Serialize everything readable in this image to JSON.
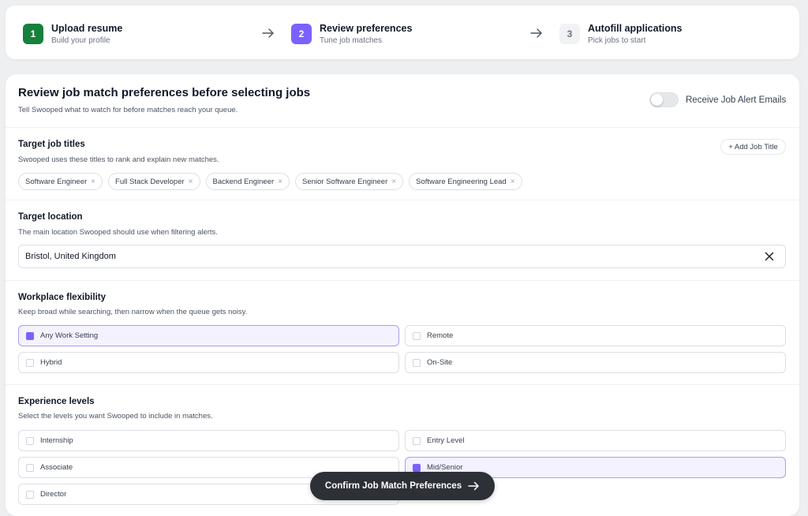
{
  "stepper": {
    "steps": [
      {
        "num": "1",
        "title": "Upload resume",
        "subtitle": "Build your profile",
        "state": "done"
      },
      {
        "num": "2",
        "title": "Review preferences",
        "subtitle": "Tune job matches",
        "state": "active"
      },
      {
        "num": "3",
        "title": "Autofill applications",
        "subtitle": "Pick jobs to start",
        "state": "todo"
      }
    ]
  },
  "header": {
    "title": "Review job match preferences before selecting jobs",
    "subtitle": "Tell Swooped what to watch for before matches reach your queue.",
    "alert_toggle_label": "Receive Job Alert Emails",
    "alert_toggle_on": false
  },
  "titles": {
    "title": "Target job titles",
    "subtitle": "Swooped uses these titles to rank and explain new matches.",
    "add_label": "+ Add Job Title",
    "chips": [
      "Software Engineer",
      "Full Stack Developer",
      "Backend Engineer",
      "Senior Software Engineer",
      "Software Engineering Lead"
    ],
    "remove_glyph": "×"
  },
  "location": {
    "title": "Target location",
    "subtitle": "The main location Swooped should use when filtering alerts.",
    "value": "Bristol, United Kingdom"
  },
  "workplace": {
    "title": "Workplace flexibility",
    "subtitle": "Keep broad while searching, then narrow when the queue gets noisy.",
    "options": [
      {
        "label": "Any Work Setting",
        "selected": true
      },
      {
        "label": "Remote",
        "selected": false
      },
      {
        "label": "Hybrid",
        "selected": false
      },
      {
        "label": "On-Site",
        "selected": false
      }
    ]
  },
  "experience": {
    "title": "Experience levels",
    "subtitle": "Select the levels you want Swooped to include in matches.",
    "options": [
      {
        "label": "Internship",
        "selected": false
      },
      {
        "label": "Entry Level",
        "selected": false
      },
      {
        "label": "Associate",
        "selected": false
      },
      {
        "label": "Mid/Senior",
        "selected": true
      },
      {
        "label": "Director",
        "selected": false
      }
    ]
  },
  "confirm_label": "Confirm Job Match Preferences",
  "colors": {
    "accent": "#7b61ff",
    "done": "#16803c",
    "dark_button": "#2d3036"
  }
}
